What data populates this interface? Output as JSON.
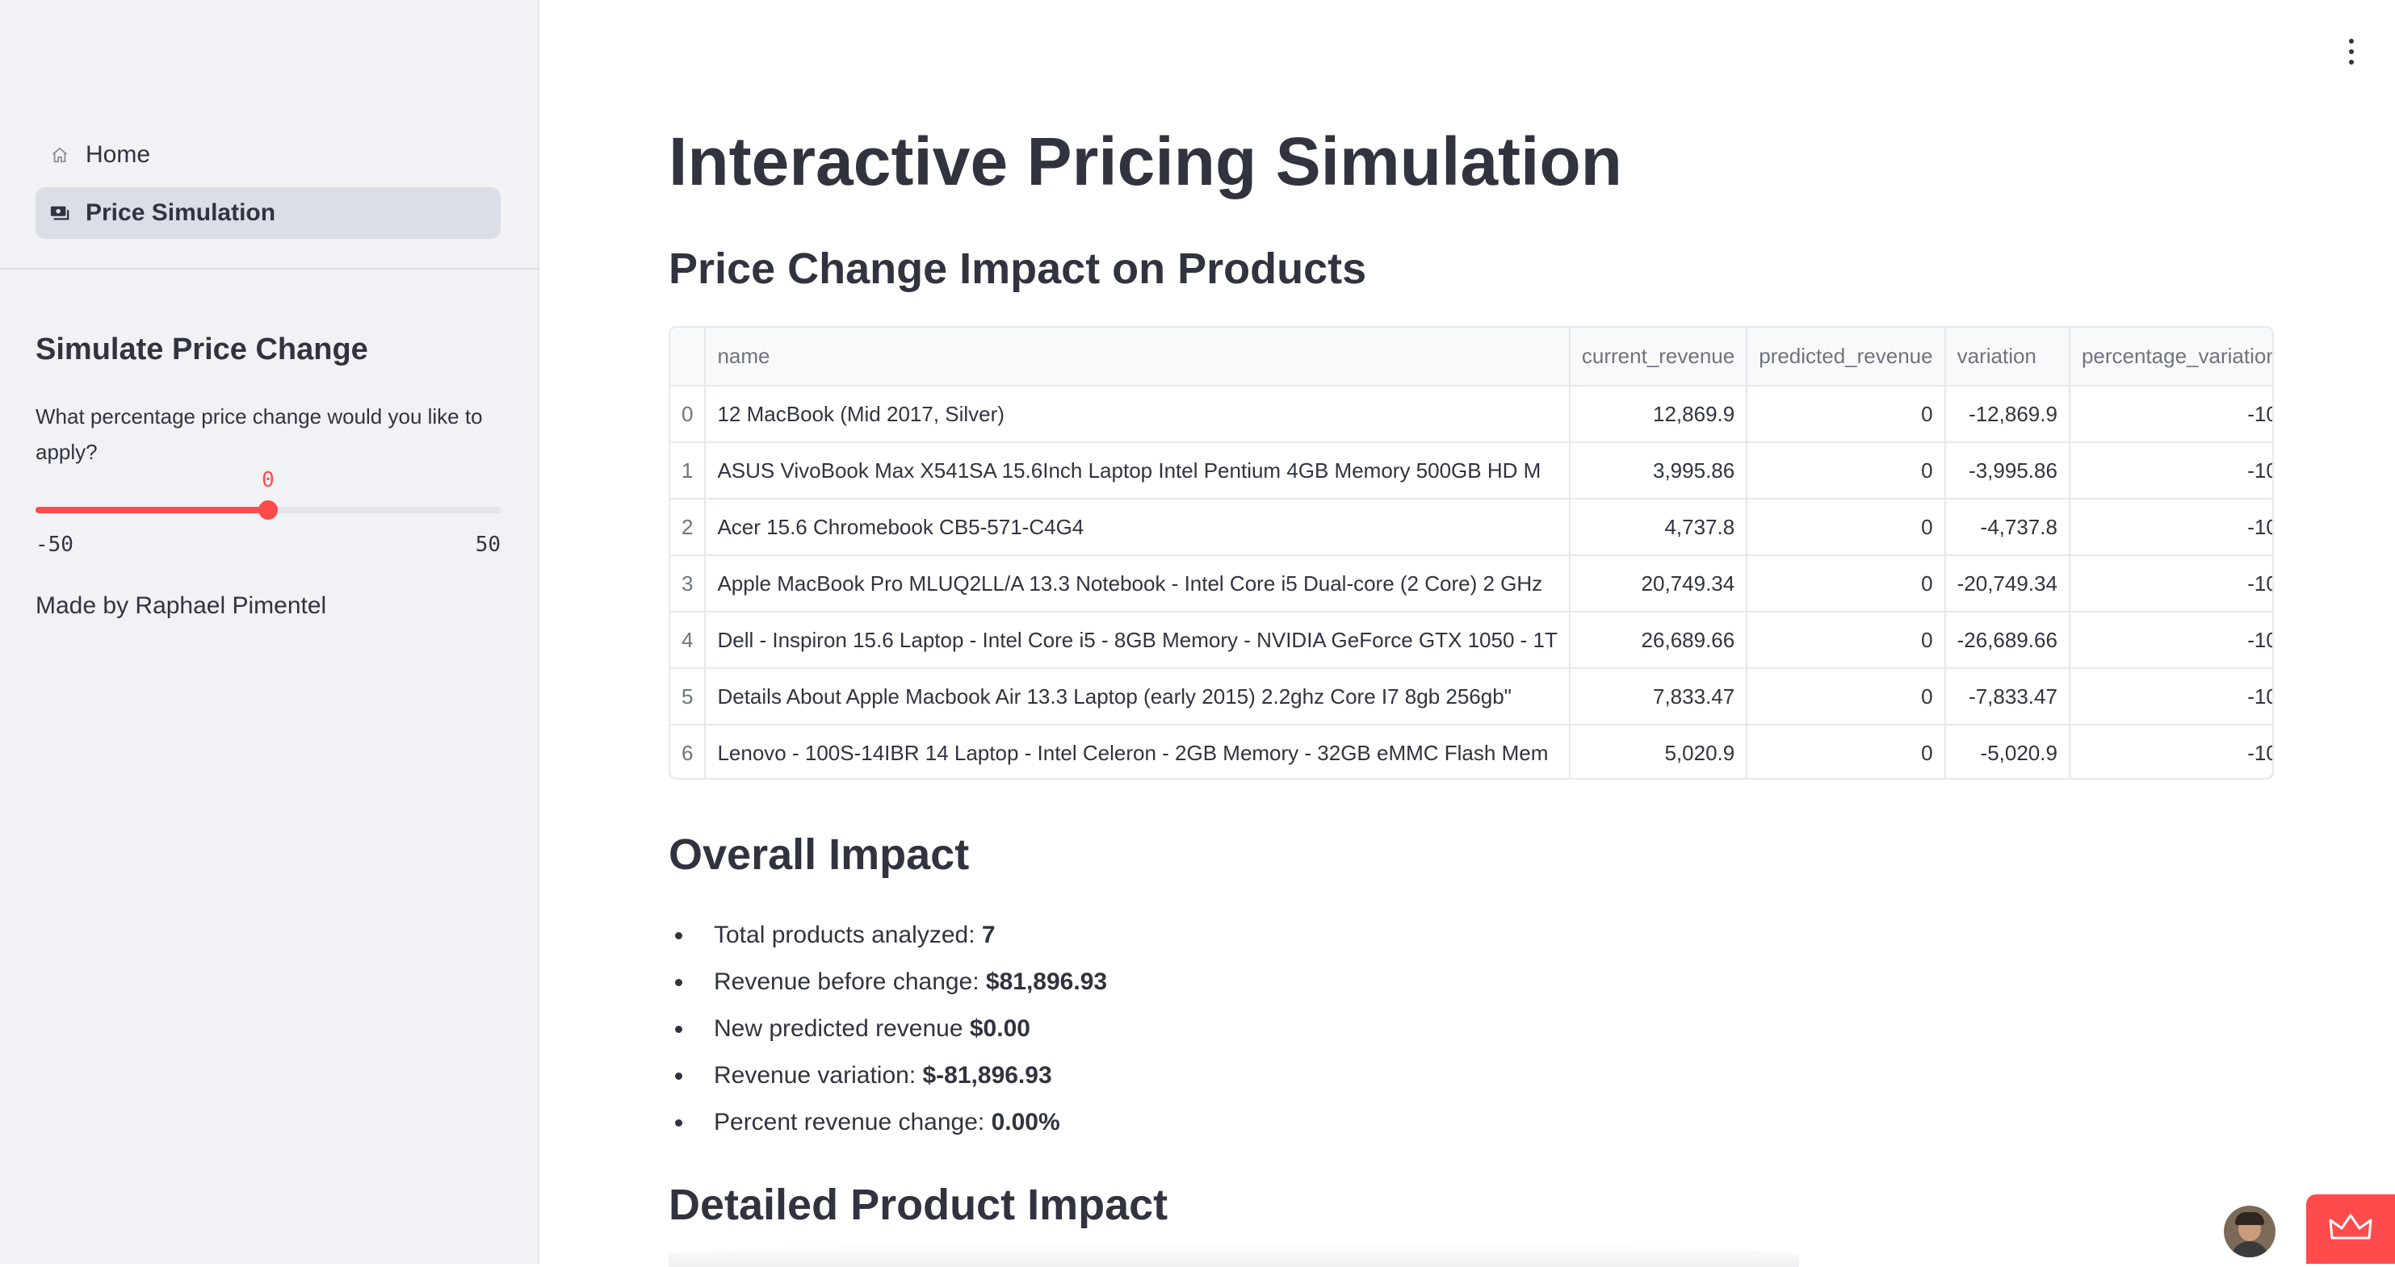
{
  "sidebar": {
    "nav": [
      {
        "label": "Home",
        "icon": "home-icon",
        "active": false
      },
      {
        "label": "Price Simulation",
        "icon": "money-icon",
        "active": true
      }
    ],
    "simulate_header": "Simulate Price Change",
    "question": "What percentage price change would you like to apply?",
    "slider": {
      "value": "0",
      "min": "-50",
      "max": "50",
      "fraction": 0.5
    },
    "credit": "Made by Raphael Pimentel"
  },
  "main": {
    "title": "Interactive Pricing Simulation",
    "table_heading": "Price Change Impact on Products",
    "table": {
      "columns": [
        "",
        "name",
        "current_revenue",
        "predicted_revenue",
        "variation",
        "percentage_variation"
      ],
      "rows": [
        [
          "0",
          "12 MacBook (Mid 2017, Silver)",
          "12,869.9",
          "0",
          "-12,869.9",
          "-10"
        ],
        [
          "1",
          "ASUS VivoBook Max X541SA 15.6Inch Laptop Intel Pentium 4GB Memory 500GB HD M",
          "3,995.86",
          "0",
          "-3,995.86",
          "-10"
        ],
        [
          "2",
          "Acer 15.6 Chromebook CB5-571-C4G4",
          "4,737.8",
          "0",
          "-4,737.8",
          "-10"
        ],
        [
          "3",
          "Apple MacBook Pro MLUQ2LL/A 13.3 Notebook - Intel Core i5 Dual-core (2 Core) 2 GHz",
          "20,749.34",
          "0",
          "-20,749.34",
          "-10"
        ],
        [
          "4",
          "Dell - Inspiron 15.6 Laptop - Intel Core i5 - 8GB Memory - NVIDIA GeForce GTX 1050 - 1T",
          "26,689.66",
          "0",
          "-26,689.66",
          "-10"
        ],
        [
          "5",
          "Details About Apple Macbook Air 13.3 Laptop (early 2015) 2.2ghz Core I7 8gb 256gb\"",
          "7,833.47",
          "0",
          "-7,833.47",
          "-10"
        ],
        [
          "6",
          "Lenovo - 100S-14IBR 14 Laptop - Intel Celeron - 2GB Memory - 32GB eMMC Flash Mem",
          "5,020.9",
          "0",
          "-5,020.9",
          "-10"
        ]
      ]
    },
    "overall_heading": "Overall Impact",
    "impact": [
      {
        "label": "Total products analyzed: ",
        "value": "7"
      },
      {
        "label": "Revenue before change: ",
        "value": "$81,896.93"
      },
      {
        "label": "New predicted revenue ",
        "value": "$0.00"
      },
      {
        "label": "Revenue variation: ",
        "value": "$-81,896.93"
      },
      {
        "label": "Percent revenue change: ",
        "value": "0.00%"
      }
    ],
    "detailed_heading": "Detailed Product Impact"
  },
  "colors": {
    "accent": "#ff4b4b",
    "sidebar_bg": "#f0f2f6",
    "text": "#31333f"
  }
}
